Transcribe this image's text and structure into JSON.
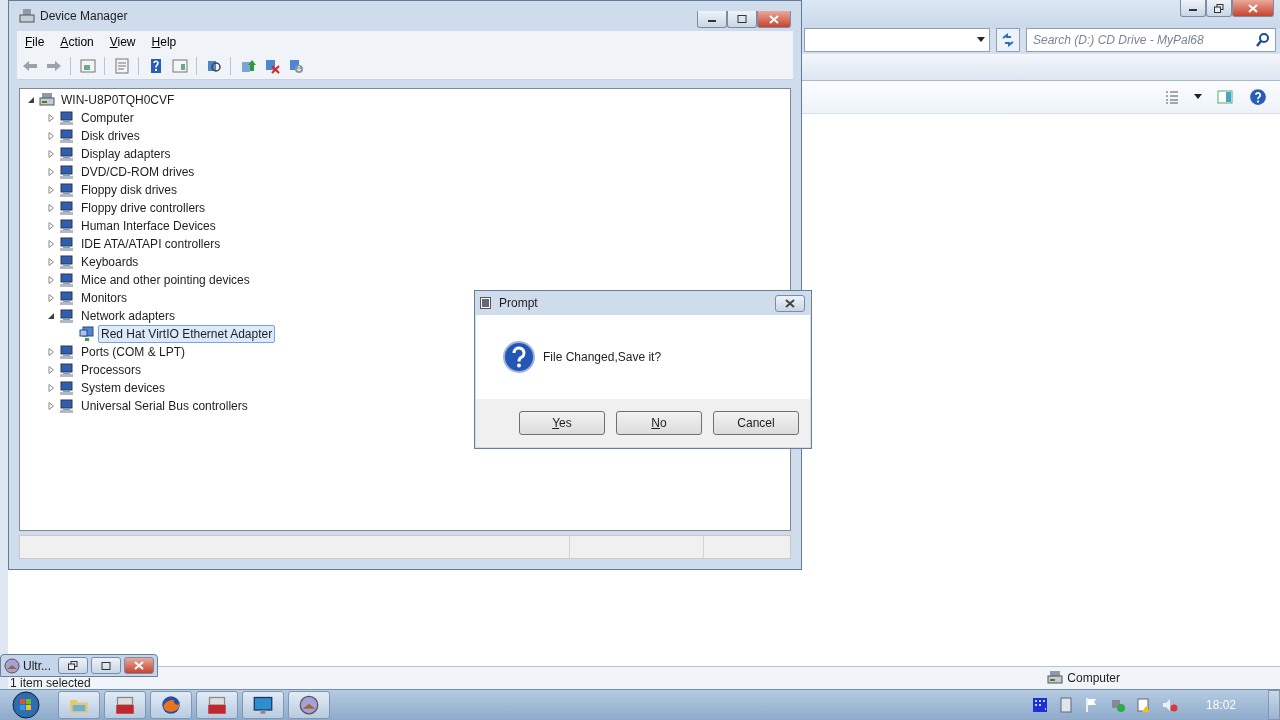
{
  "explorer": {
    "search": {
      "placeholder": "Search (D:) CD Drive - MyPal68"
    },
    "status_text": "1 item selected",
    "status_location": "Computer"
  },
  "device_manager": {
    "title": "Device Manager",
    "menu": [
      {
        "label": "File",
        "underline_first": true
      },
      {
        "label": "Action",
        "underline_first": true
      },
      {
        "label": "View",
        "underline_first": true
      },
      {
        "label": "Help",
        "underline_first": true
      }
    ],
    "tree": {
      "label": "WIN-U8P0TQH0CVF",
      "expanded": true,
      "selected": false,
      "children": [
        {
          "label": "Computer",
          "expanded": false,
          "selected": false
        },
        {
          "label": "Disk drives",
          "expanded": false,
          "selected": false
        },
        {
          "label": "Display adapters",
          "expanded": false,
          "selected": false
        },
        {
          "label": "DVD/CD-ROM drives",
          "expanded": false,
          "selected": false
        },
        {
          "label": "Floppy disk drives",
          "expanded": false,
          "selected": false
        },
        {
          "label": "Floppy drive controllers",
          "expanded": false,
          "selected": false
        },
        {
          "label": "Human Interface Devices",
          "expanded": false,
          "selected": false
        },
        {
          "label": "IDE ATA/ATAPI controllers",
          "expanded": false,
          "selected": false
        },
        {
          "label": "Keyboards",
          "expanded": false,
          "selected": false
        },
        {
          "label": "Mice and other pointing devices",
          "expanded": false,
          "selected": false
        },
        {
          "label": "Monitors",
          "expanded": false,
          "selected": false
        },
        {
          "label": "Network adapters",
          "expanded": true,
          "selected": false,
          "children": [
            {
              "label": "Red Hat VirtIO Ethernet Adapter",
              "selected": true
            }
          ]
        },
        {
          "label": "Ports (COM & LPT)",
          "expanded": false,
          "selected": false
        },
        {
          "label": "Processors",
          "expanded": false,
          "selected": false
        },
        {
          "label": "System devices",
          "expanded": false,
          "selected": false
        },
        {
          "label": "Universal Serial Bus controllers",
          "expanded": false,
          "selected": false
        }
      ]
    }
  },
  "dialog": {
    "title": "Prompt",
    "message": "File Changed,Save it?",
    "buttons": [
      {
        "label": "Yes",
        "underline_first": true
      },
      {
        "label": "No",
        "underline_first": true
      },
      {
        "label": "Cancel",
        "underline_first": false
      }
    ]
  },
  "minimized_window": {
    "title": "Ultr..."
  },
  "taskbar": {
    "clock": "18:02"
  }
}
